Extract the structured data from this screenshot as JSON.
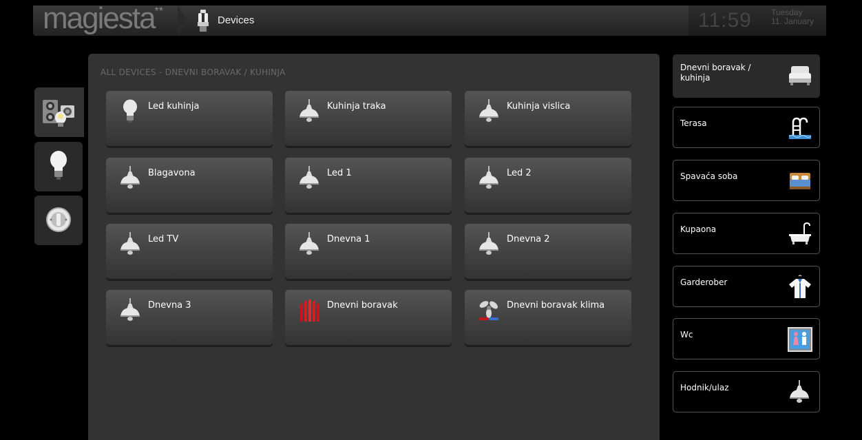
{
  "header": {
    "logo": "magiesta",
    "logo_mark": "**",
    "breadcrumb": "Devices",
    "time": "11:59",
    "weekday": "Tuesday",
    "date": "11. January"
  },
  "left_tabs": [
    {
      "name": "devices-tab",
      "icon": "devices-icon",
      "active": true
    },
    {
      "name": "lighting-tab",
      "icon": "bulb-icon",
      "active": false
    },
    {
      "name": "switch-tab",
      "icon": "switch-icon",
      "active": false
    }
  ],
  "main": {
    "title": "ALL DEVICES - DNEVNI BORAVAK / KUHINJA",
    "devices": [
      {
        "label": "Led kuhinja",
        "icon": "bulb-icon"
      },
      {
        "label": "Kuhinja traka",
        "icon": "lamp-icon"
      },
      {
        "label": "Kuhinja vislica",
        "icon": "lamp-icon"
      },
      {
        "label": "Blagavona",
        "icon": "lamp-icon"
      },
      {
        "label": "Led 1",
        "icon": "lamp-icon"
      },
      {
        "label": "Led 2",
        "icon": "lamp-icon"
      },
      {
        "label": "Led TV",
        "icon": "lamp-icon"
      },
      {
        "label": "Dnevna 1",
        "icon": "lamp-icon"
      },
      {
        "label": "Dnevna 2",
        "icon": "lamp-icon"
      },
      {
        "label": "Dnevna 3",
        "icon": "lamp-icon"
      },
      {
        "label": "Dnevni boravak",
        "icon": "heater-icon"
      },
      {
        "label": "Dnevni boravak klima",
        "icon": "fan-icon"
      }
    ]
  },
  "rooms": [
    {
      "label": "Dnevni boravak / kuhinja",
      "icon": "sofa-icon",
      "active": true
    },
    {
      "label": "Terasa",
      "icon": "pool-icon",
      "active": false
    },
    {
      "label": "Spavaća soba",
      "icon": "bed-icon",
      "active": false
    },
    {
      "label": "Kupaona",
      "icon": "bathtub-icon",
      "active": false
    },
    {
      "label": "Garderober",
      "icon": "shirt-icon",
      "active": false
    },
    {
      "label": "Wc",
      "icon": "wc-icon",
      "active": false
    },
    {
      "label": "Hodnik/ulaz",
      "icon": "lamp-icon",
      "active": false
    }
  ],
  "colors": {
    "accent_heater": "#c4161c",
    "panel": "#333333",
    "background": "#000000"
  }
}
